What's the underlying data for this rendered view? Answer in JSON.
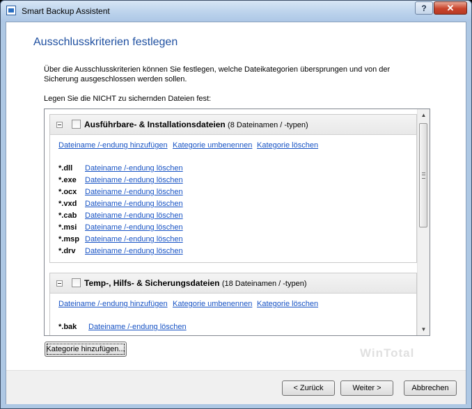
{
  "window": {
    "title": "Smart Backup Assistent",
    "help_label": "?",
    "close_label": "✕"
  },
  "page": {
    "heading": "Ausschlusskriterien festlegen",
    "intro": "Über die Ausschlusskriterien können Sie festlegen, welche Dateikategorien übersprungen und von der Sicherung ausgeschlossen werden sollen.",
    "list_label": "Legen Sie die NICHT zu sichernden Dateien fest:"
  },
  "categories": [
    {
      "name": "Ausführbare- & Installationsdateien",
      "count": "(8 Dateinamen / -typen)",
      "checked": false,
      "add_link": "Dateiname /-endung hinzufügen",
      "rename_link": "Kategorie umbenennen",
      "delete_link": "Kategorie löschen",
      "entries": [
        {
          "ext": "*.dll",
          "delete": "Dateiname /-endung löschen"
        },
        {
          "ext": "*.exe",
          "delete": "Dateiname /-endung löschen"
        },
        {
          "ext": "*.ocx",
          "delete": "Dateiname /-endung löschen"
        },
        {
          "ext": "*.vxd",
          "delete": "Dateiname /-endung löschen"
        },
        {
          "ext": "*.cab",
          "delete": "Dateiname /-endung löschen"
        },
        {
          "ext": "*.msi",
          "delete": "Dateiname /-endung löschen"
        },
        {
          "ext": "*.msp",
          "delete": "Dateiname /-endung löschen"
        },
        {
          "ext": "*.drv",
          "delete": "Dateiname /-endung löschen"
        }
      ]
    },
    {
      "name": "Temp-, Hilfs- & Sicherungsdateien",
      "count": "(18 Dateinamen / -typen)",
      "checked": false,
      "add_link": "Dateiname /-endung hinzufügen",
      "rename_link": "Kategorie umbenennen",
      "delete_link": "Kategorie löschen",
      "entries": [
        {
          "ext": "*.bak",
          "delete": "Dateiname /-endung löschen"
        }
      ]
    }
  ],
  "buttons": {
    "add_category": "Kategorie hinzufügen...",
    "back": "< Zurück",
    "next": "Weiter >",
    "cancel": "Abbrechen"
  },
  "watermark": "WinTotal",
  "icons": {
    "app": "backup-app-icon",
    "collapse": "minus-box-icon",
    "scroll_up": "chevron-up-icon",
    "scroll_down": "chevron-down-icon"
  }
}
